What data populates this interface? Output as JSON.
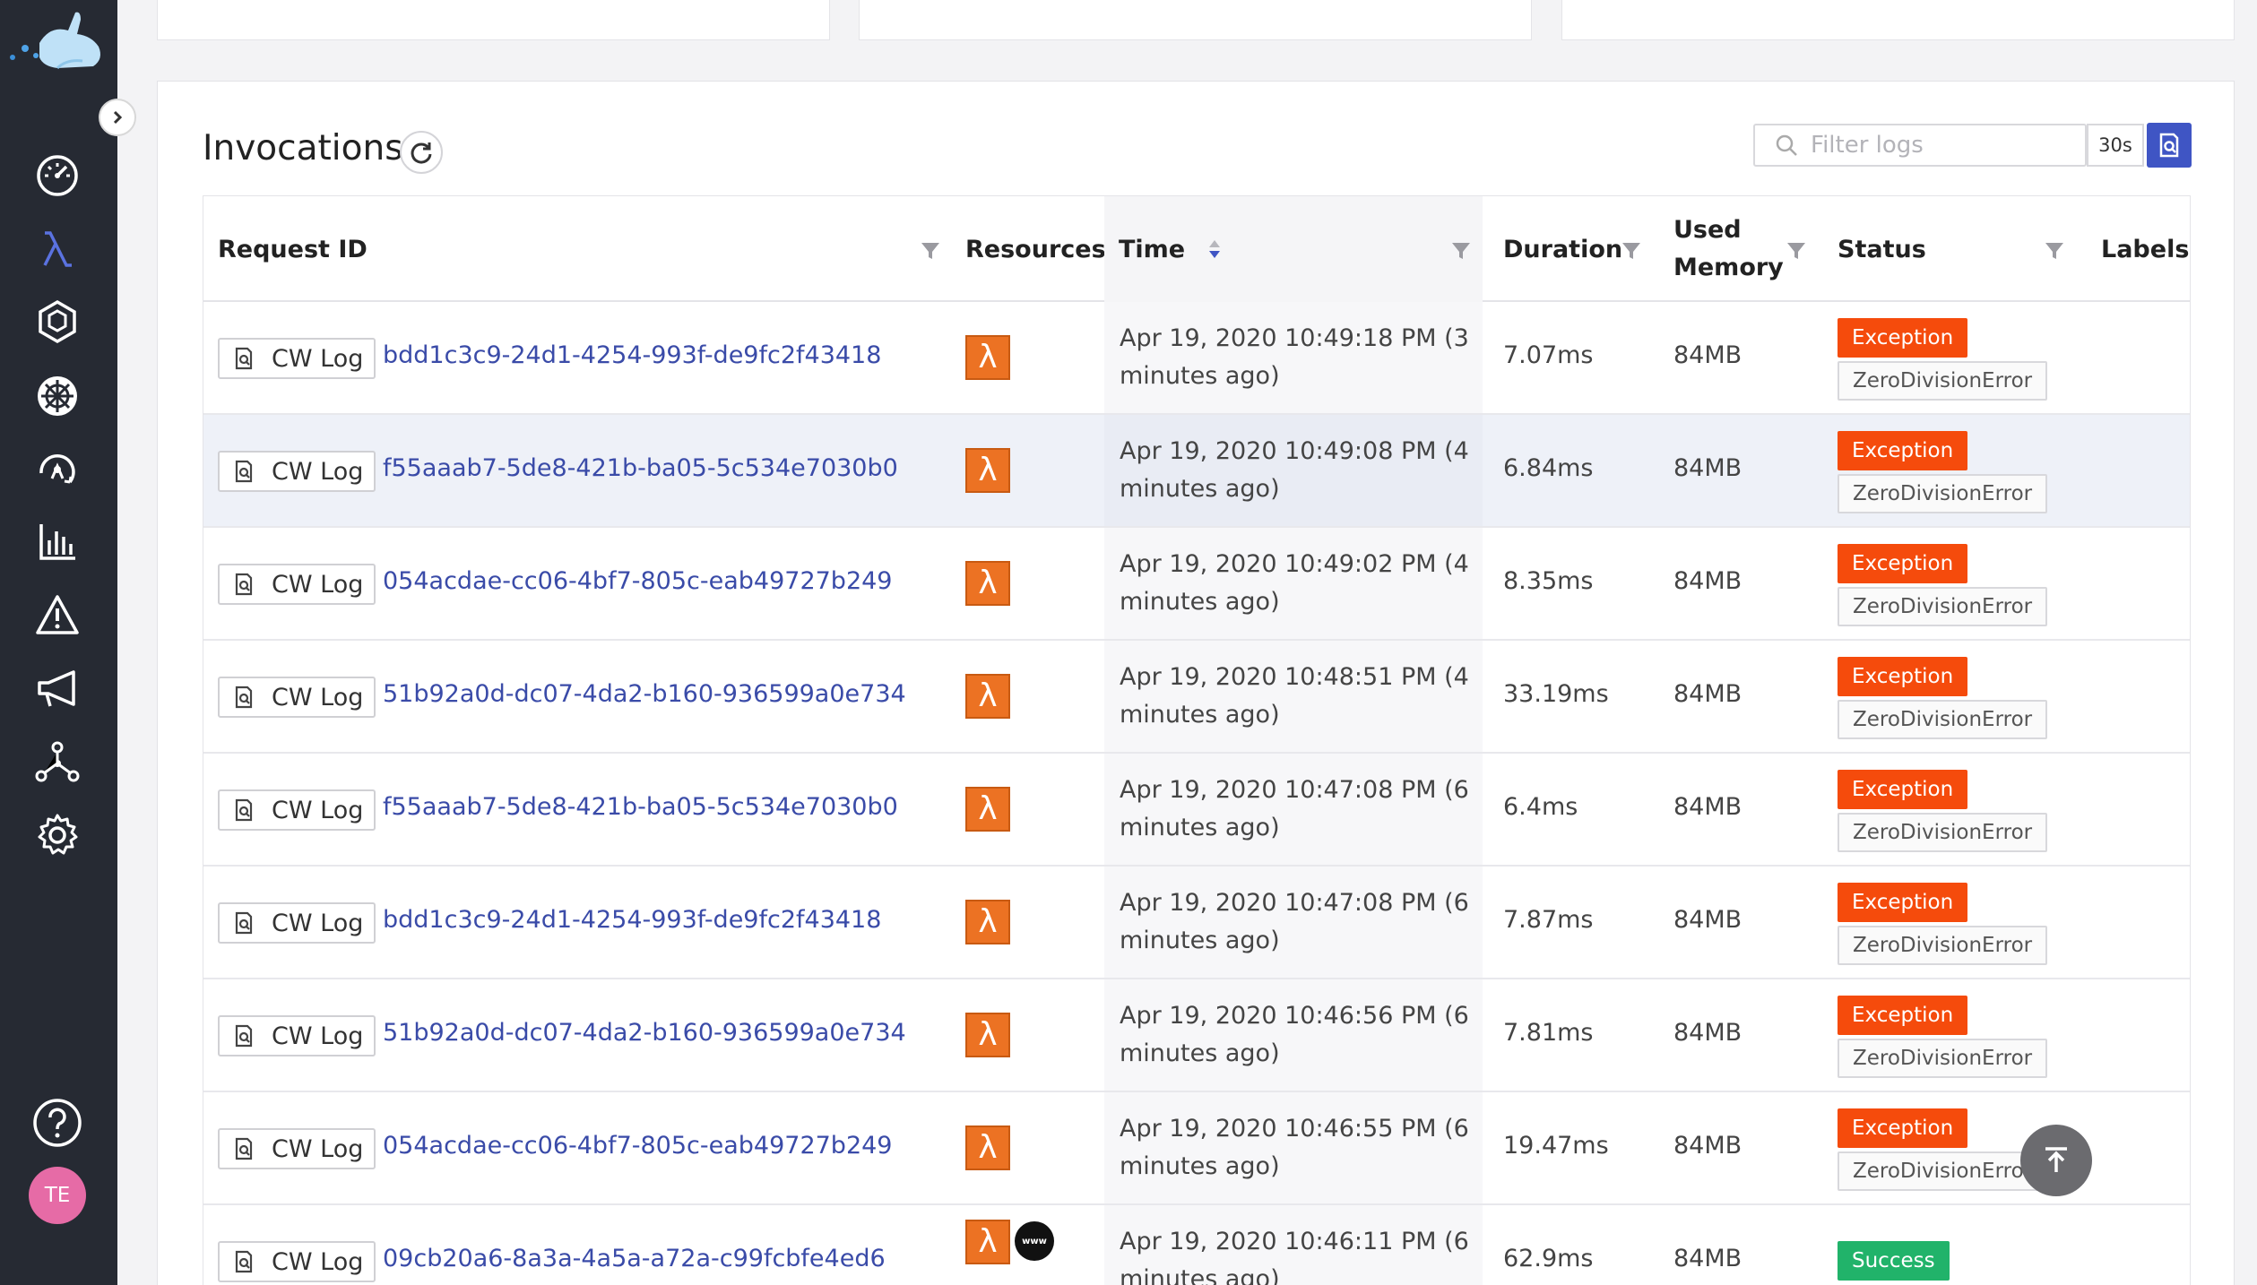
{
  "sidebar": {
    "user_initials": "TE",
    "active_item": "functions",
    "items": [
      {
        "name": "dashboard",
        "icon": "dashboard-gauge-icon"
      },
      {
        "name": "functions",
        "icon": "lambda-icon"
      },
      {
        "name": "resources",
        "icon": "hexagon-icon"
      },
      {
        "name": "kubernetes",
        "icon": "helm-wheel-icon"
      },
      {
        "name": "architecture",
        "icon": "architecture-icon"
      },
      {
        "name": "metrics",
        "icon": "bar-chart-icon"
      },
      {
        "name": "alerts",
        "icon": "warning-icon"
      },
      {
        "name": "announcements",
        "icon": "megaphone-icon"
      },
      {
        "name": "integrations",
        "icon": "network-icon"
      },
      {
        "name": "settings",
        "icon": "gear-icon"
      }
    ],
    "help_icon": "help-icon",
    "accent_color": "#3f55c4"
  },
  "invocations": {
    "title": "Invocations",
    "filter_placeholder": "Filter logs",
    "interval": "30s",
    "columns": {
      "request_id": "Request ID",
      "resources": "Resources",
      "time": "Time",
      "duration": "Duration",
      "memory_line1": "Used",
      "memory_line2": "Memory",
      "status": "Status",
      "labels": "Labels"
    },
    "cw_log_label": "CW Log",
    "rows": [
      {
        "id": "bdd1c3c9-24d1-4254-993f-de9fc2f43418",
        "time1": "Apr 19, 2020 10:49:18 PM (3",
        "time2": "minutes ago)",
        "duration": "7.07ms",
        "memory": "84MB",
        "status": "Exception",
        "error": "ZeroDivisionError",
        "resources": [
          "lambda"
        ]
      },
      {
        "id": "f55aaab7-5de8-421b-ba05-5c534e7030b0",
        "time1": "Apr 19, 2020 10:49:08 PM (4",
        "time2": "minutes ago)",
        "duration": "6.84ms",
        "memory": "84MB",
        "status": "Exception",
        "error": "ZeroDivisionError",
        "resources": [
          "lambda"
        ]
      },
      {
        "id": "054acdae-cc06-4bf7-805c-eab49727b249",
        "time1": "Apr 19, 2020 10:49:02 PM (4",
        "time2": "minutes ago)",
        "duration": "8.35ms",
        "memory": "84MB",
        "status": "Exception",
        "error": "ZeroDivisionError",
        "resources": [
          "lambda"
        ]
      },
      {
        "id": "51b92a0d-dc07-4da2-b160-936599a0e734",
        "time1": "Apr 19, 2020 10:48:51 PM (4",
        "time2": "minutes ago)",
        "duration": "33.19ms",
        "memory": "84MB",
        "status": "Exception",
        "error": "ZeroDivisionError",
        "resources": [
          "lambda"
        ]
      },
      {
        "id": "f55aaab7-5de8-421b-ba05-5c534e7030b0",
        "time1": "Apr 19, 2020 10:47:08 PM (6",
        "time2": "minutes ago)",
        "duration": "6.4ms",
        "memory": "84MB",
        "status": "Exception",
        "error": "ZeroDivisionError",
        "resources": [
          "lambda"
        ]
      },
      {
        "id": "bdd1c3c9-24d1-4254-993f-de9fc2f43418",
        "time1": "Apr 19, 2020 10:47:08 PM (6",
        "time2": "minutes ago)",
        "duration": "7.87ms",
        "memory": "84MB",
        "status": "Exception",
        "error": "ZeroDivisionError",
        "resources": [
          "lambda"
        ]
      },
      {
        "id": "51b92a0d-dc07-4da2-b160-936599a0e734",
        "time1": "Apr 19, 2020 10:46:56 PM (6",
        "time2": "minutes ago)",
        "duration": "7.81ms",
        "memory": "84MB",
        "status": "Exception",
        "error": "ZeroDivisionError",
        "resources": [
          "lambda"
        ]
      },
      {
        "id": "054acdae-cc06-4bf7-805c-eab49727b249",
        "time1": "Apr 19, 2020 10:46:55 PM (6",
        "time2": "minutes ago)",
        "duration": "19.47ms",
        "memory": "84MB",
        "status": "Exception",
        "error": "ZeroDivisionError",
        "resources": [
          "lambda"
        ]
      },
      {
        "id": "09cb20a6-8a3a-4a5a-a72a-c99fcbfe4ed6",
        "time1": "Apr 19, 2020 10:46:11 PM (6",
        "time2": "minutes ago)",
        "duration": "62.9ms",
        "memory": "84MB",
        "status": "Success",
        "error": "",
        "resources": [
          "lambda",
          "www"
        ]
      }
    ],
    "colors": {
      "exception": "#f54b0c",
      "success": "#21b36a",
      "link": "#3a4ba8",
      "lambda": "#ec7223"
    }
  }
}
